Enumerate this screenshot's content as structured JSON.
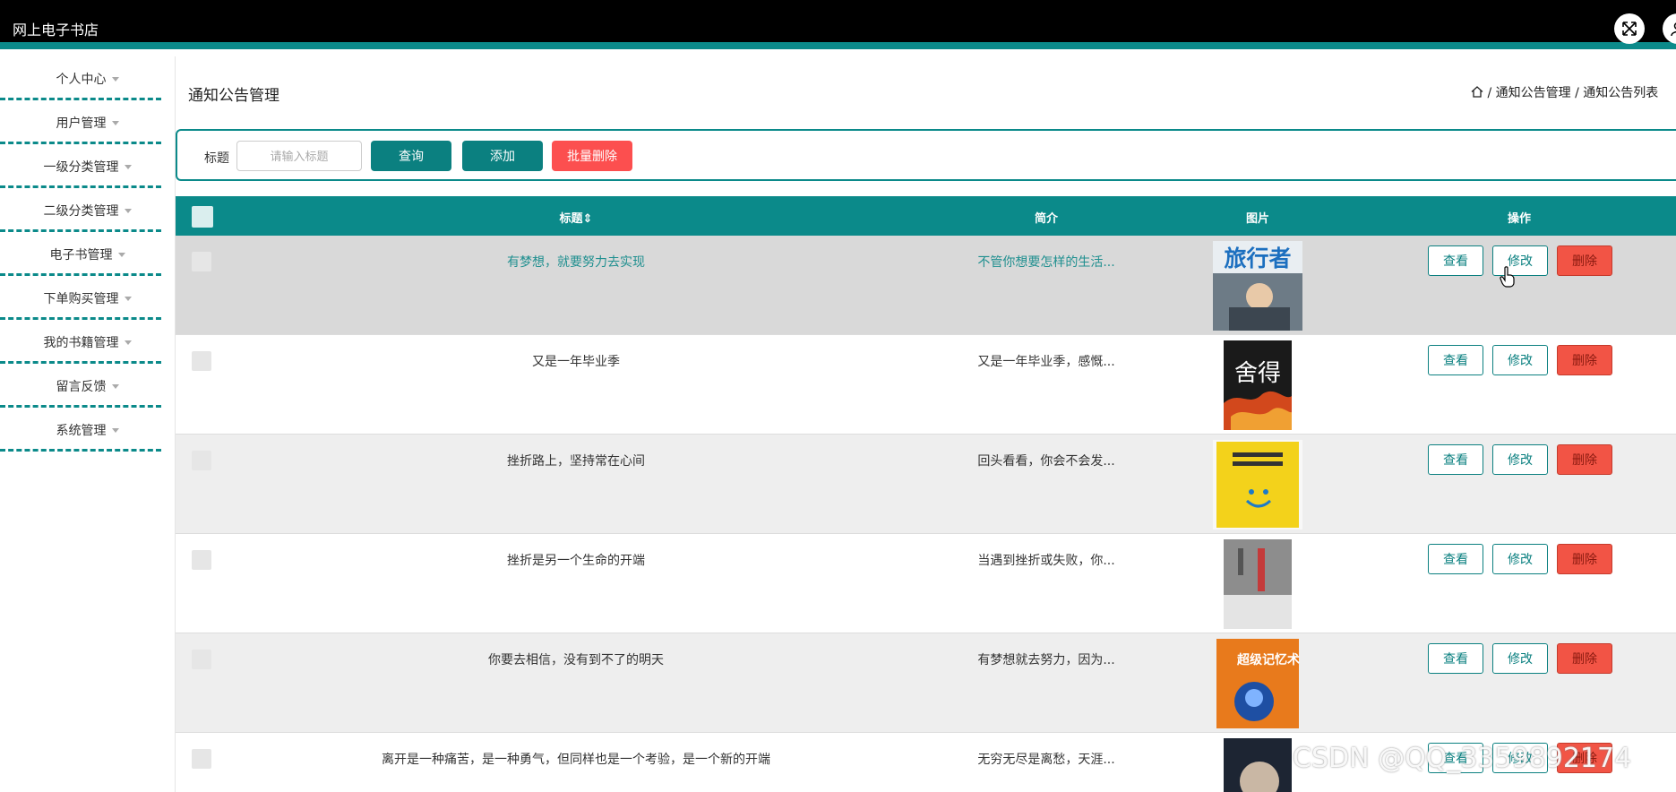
{
  "app": {
    "title": "网上电子书店"
  },
  "header_icons": [
    "fullscreen-icon",
    "user-icon"
  ],
  "sidebar": {
    "items": [
      {
        "label": "个人中心"
      },
      {
        "label": "用户管理"
      },
      {
        "label": "一级分类管理"
      },
      {
        "label": "二级分类管理"
      },
      {
        "label": "电子书管理"
      },
      {
        "label": "下单购买管理"
      },
      {
        "label": "我的书籍管理"
      },
      {
        "label": "留言反馈"
      },
      {
        "label": "系统管理"
      }
    ]
  },
  "page": {
    "heading": "通知公告管理",
    "breadcrumb": [
      "通知公告管理",
      "通知公告列表"
    ]
  },
  "search": {
    "label": "标题",
    "placeholder": "请输入标题",
    "query_btn": "查询",
    "add_btn": "添加",
    "batch_delete_btn": "批量删除"
  },
  "table": {
    "headers": {
      "title": "标题",
      "summary": "简介",
      "image": "图片",
      "actions": "操作"
    },
    "action_labels": {
      "view": "查看",
      "edit": "修改",
      "delete": "删除"
    },
    "rows": [
      {
        "title": "有梦想，就要努力去实现",
        "summary": "不管你想要怎样的生活...",
        "highlight": true,
        "cover_text": "旅行者"
      },
      {
        "title": "又是一年毕业季",
        "summary": "又是一年毕业季，感慨...",
        "highlight": false,
        "cover_text": "舍得"
      },
      {
        "title": "挫折路上，坚持常在心间",
        "summary": "回头看看，你会不会发...",
        "highlight": false,
        "cover_text": ""
      },
      {
        "title": "挫折是另一个生命的开端",
        "summary": "当遇到挫折或失败，你...",
        "highlight": false,
        "cover_text": ""
      },
      {
        "title": "你要去相信，没有到不了的明天",
        "summary": "有梦想就去努力，因为...",
        "highlight": false,
        "cover_text": "超级记忆术"
      },
      {
        "title": "离开是一种痛苦，是一种勇气，但同样也是一个考验，是一个新的开端",
        "summary": "无穷无尽是离愁，天涯...",
        "highlight": false,
        "cover_text": ""
      }
    ]
  },
  "watermark": "CSDN @QQ_3359892174",
  "colors": {
    "primary": "#0b8a8a",
    "danger": "#fc4f4f",
    "highlight_row": "#d9d9d9",
    "alt_row": "#eeeeee"
  }
}
